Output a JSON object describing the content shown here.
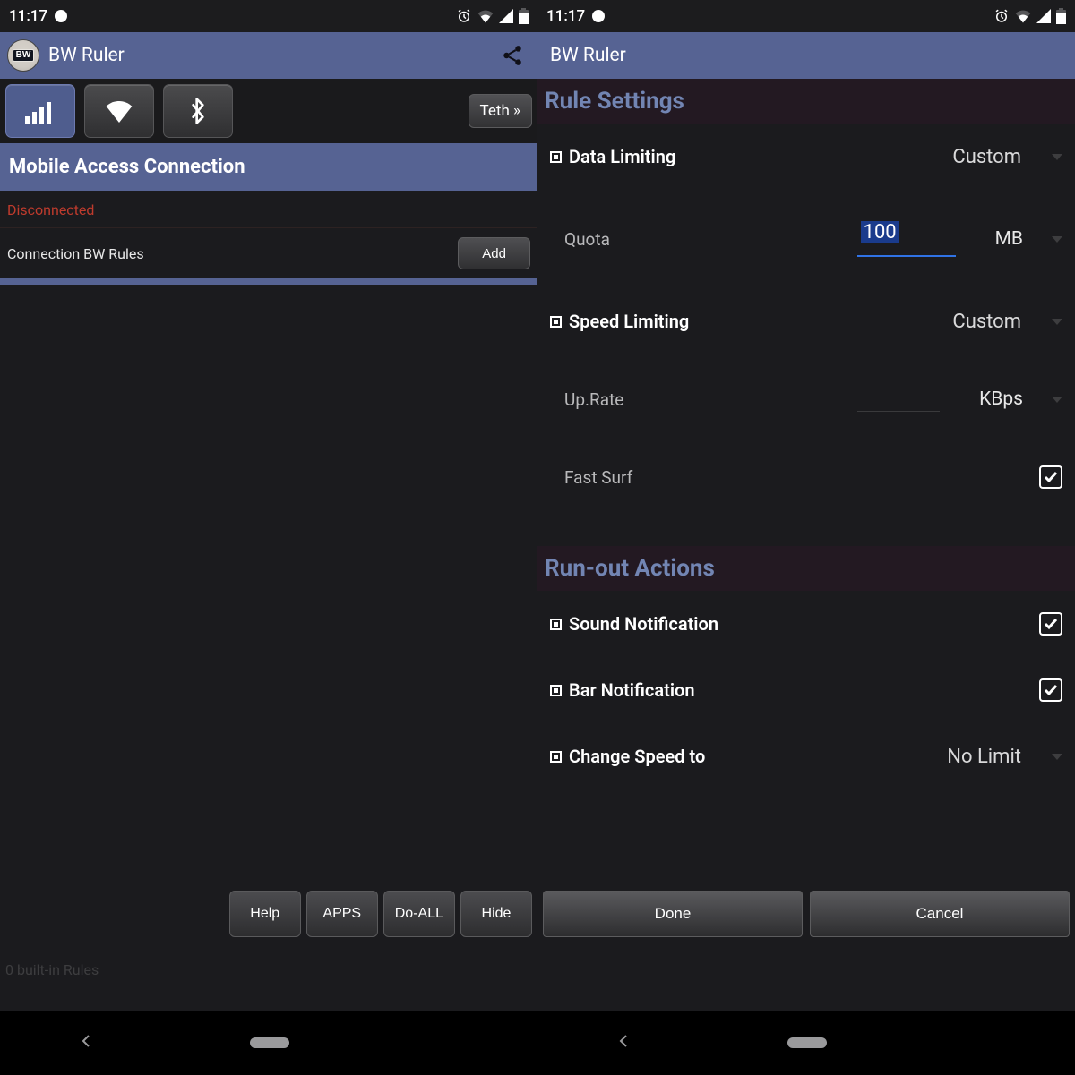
{
  "status": {
    "time": "11:17"
  },
  "app": {
    "title": "BW Ruler",
    "icon_text": "BW"
  },
  "left": {
    "teth": "Teth »",
    "section": "Mobile Access Connection",
    "status_text": "Disconnected",
    "rules_label": "Connection BW Rules",
    "add": "Add",
    "builtin": "0 built-in Rules",
    "buttons": {
      "help": "Help",
      "apps": "APPS",
      "doall": "Do-ALL",
      "hide": "Hide"
    }
  },
  "right": {
    "heading1": "Rule Settings",
    "data_limiting": {
      "label": "Data Limiting",
      "value": "Custom"
    },
    "quota": {
      "label": "Quota",
      "value": "100",
      "unit": "MB"
    },
    "speed_limiting": {
      "label": "Speed Limiting",
      "value": "Custom"
    },
    "uprate": {
      "label": "Up.Rate",
      "unit": "KBps"
    },
    "fastsurf": {
      "label": "Fast Surf",
      "checked": true
    },
    "heading2": "Run-out Actions",
    "sound": {
      "label": "Sound Notification",
      "checked": true
    },
    "bar": {
      "label": "Bar Notification",
      "checked": true
    },
    "change_speed": {
      "label": "Change Speed to",
      "value": "No Limit"
    },
    "buttons": {
      "done": "Done",
      "cancel": "Cancel"
    }
  }
}
